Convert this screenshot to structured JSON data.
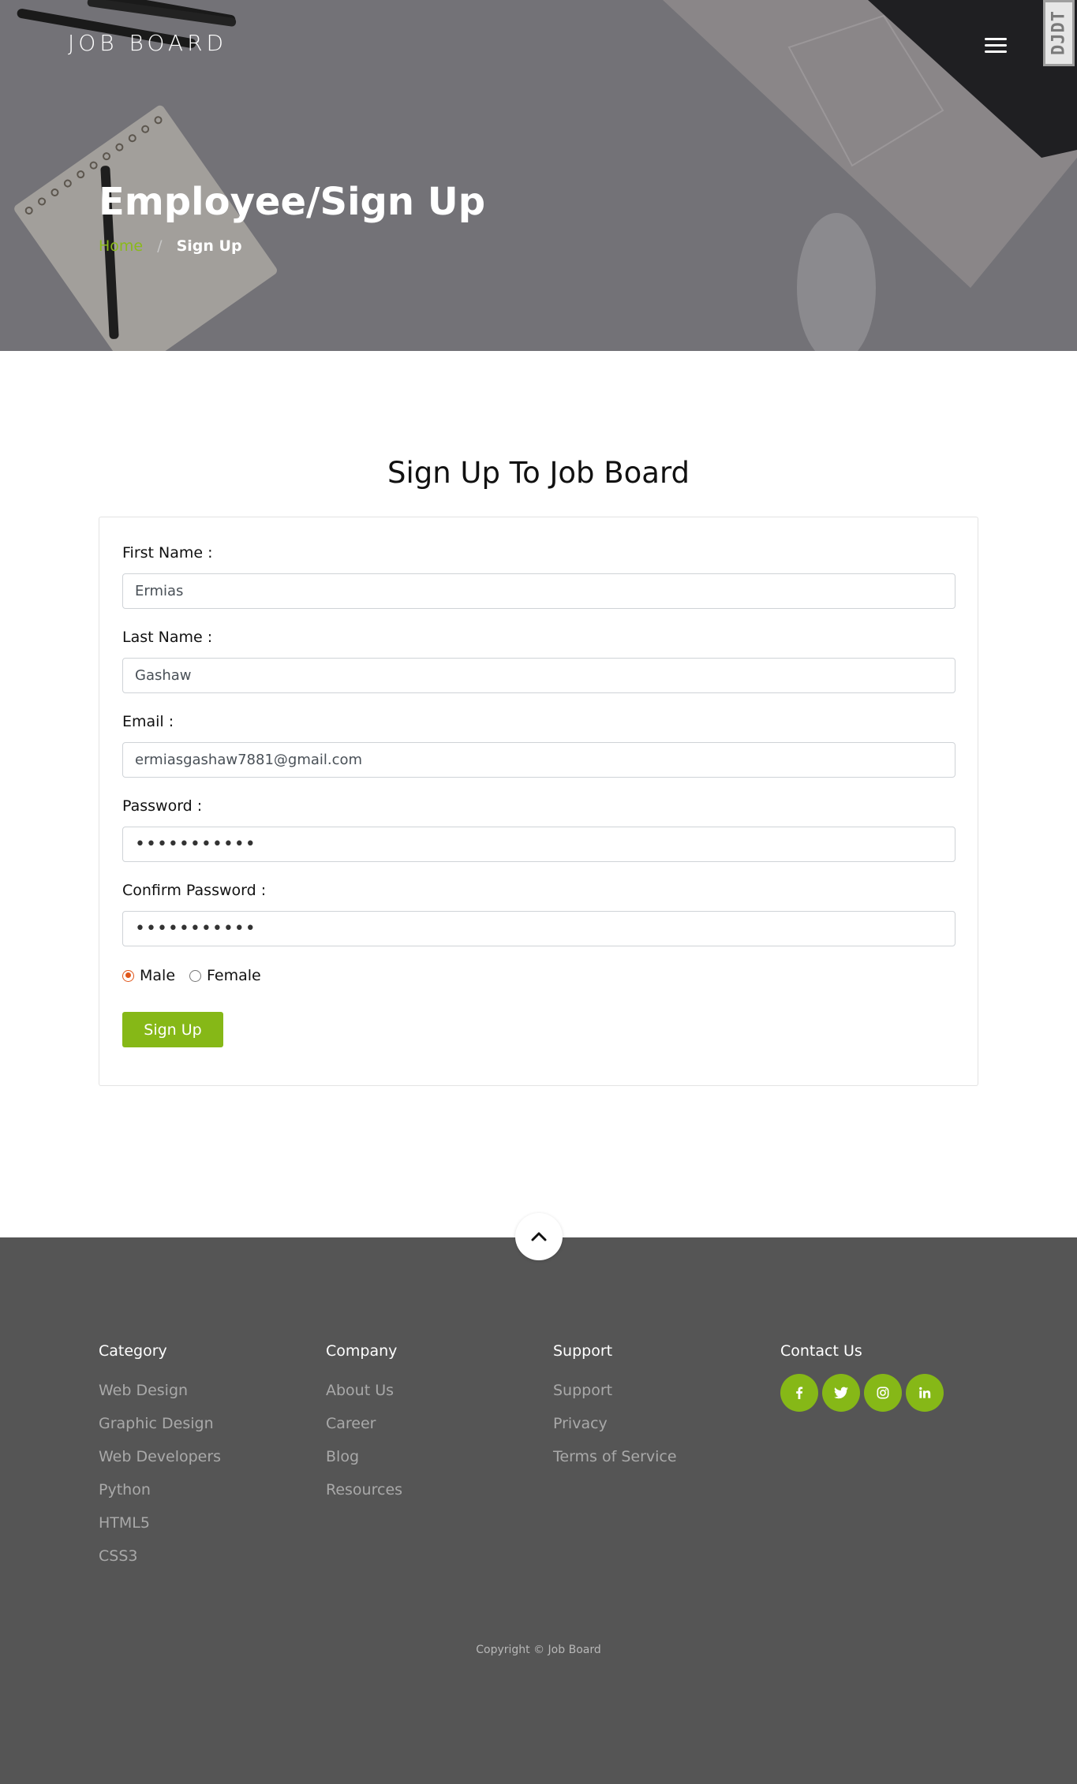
{
  "header": {
    "brand": "JOB BOARD",
    "menu_icon": "hamburger-menu-icon",
    "debug_toolbar": "DJDT"
  },
  "hero": {
    "title": "Employee/Sign Up",
    "breadcrumb": {
      "home": "Home",
      "separator": "/",
      "current": "Sign Up"
    }
  },
  "form": {
    "title": "Sign Up To Job Board",
    "fields": [
      {
        "label": "First Name :",
        "value": "Ermias"
      },
      {
        "label": "Last Name :",
        "value": "Gashaw"
      },
      {
        "label": "Email :",
        "value": "ermiasgashaw7881@gmail.com"
      },
      {
        "label": "Password :",
        "value": "•••••••••••"
      },
      {
        "label": "Confirm Password :",
        "value": "•••••••••••"
      }
    ],
    "gender": {
      "male": "Male",
      "female": "Female",
      "selected": "Male"
    },
    "submit_label": "Sign Up"
  },
  "footer": {
    "scroll_top_icon": "chevron-up-icon",
    "columns": [
      {
        "heading": "Category",
        "links": [
          "Web Design",
          "Graphic Design",
          "Web Developers",
          "Python",
          "HTML5",
          "CSS3"
        ]
      },
      {
        "heading": "Company",
        "links": [
          "About Us",
          "Career",
          "Blog",
          "Resources"
        ]
      },
      {
        "heading": "Support",
        "links": [
          "Support",
          "Privacy",
          "Terms of Service"
        ]
      },
      {
        "heading": "Contact Us",
        "socials": [
          "facebook-icon",
          "twitter-icon",
          "instagram-icon",
          "linkedin-icon"
        ]
      }
    ],
    "copyright": "Copyright © Job Board"
  },
  "colors": {
    "accent": "#86b817",
    "radio": "#e0561a",
    "footer_bg": "#555555",
    "hero_overlay": "#737277"
  }
}
